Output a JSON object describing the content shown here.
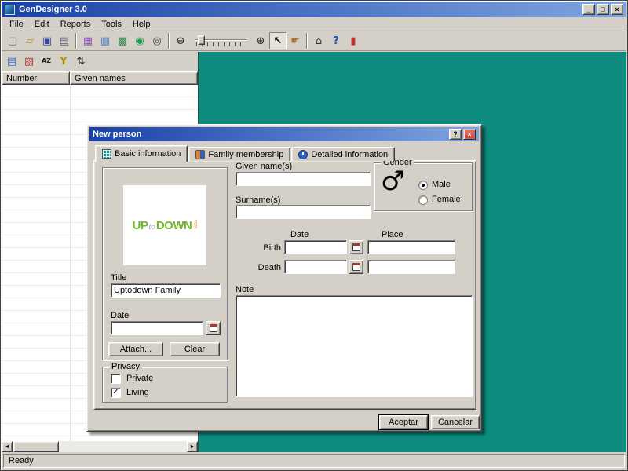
{
  "colors": {
    "workspace_teal": "#0e8c80",
    "titlebar_blue_dark": "#1941a5",
    "titlebar_blue_light": "#7fa5e0",
    "dialog_close_red": "#cf4032",
    "logo_green": "#76b82a",
    "logo_orange": "#f39200"
  },
  "window": {
    "title": "GenDesigner 3.0",
    "controls": {
      "minimize": "_",
      "maximize": "□",
      "close": "×"
    }
  },
  "menu": {
    "items": [
      "File",
      "Edit",
      "Reports",
      "Tools",
      "Help"
    ]
  },
  "toolbar_main": {
    "pointer_active": true,
    "items": [
      {
        "name": "new-document-icon",
        "glyph": "▢"
      },
      {
        "name": "open-folder-icon",
        "glyph": "▱"
      },
      {
        "name": "save-icon",
        "glyph": "▣"
      },
      {
        "name": "print-icon",
        "glyph": "▤"
      },
      {
        "name": "photo-album-icon",
        "glyph": "▦"
      },
      {
        "name": "chart-icon",
        "glyph": "▥"
      },
      {
        "name": "family-tree-icon",
        "glyph": "▩"
      },
      {
        "name": "world-icon",
        "glyph": "◉"
      },
      {
        "name": "find-icon",
        "glyph": "◎"
      },
      {
        "name": "zoom-out-icon",
        "glyph": "⊖"
      },
      {
        "name": "zoom-in-icon",
        "glyph": "⊕"
      },
      {
        "name": "pointer-tool-icon",
        "glyph": "↖"
      },
      {
        "name": "pan-tool-icon",
        "glyph": "☛"
      },
      {
        "name": "home-icon",
        "glyph": "⌂"
      },
      {
        "name": "help-icon",
        "glyph": "?"
      },
      {
        "name": "exit-icon",
        "glyph": "▮"
      }
    ]
  },
  "toolbar_panel": {
    "items": [
      {
        "name": "list-view-icon",
        "glyph": "▤"
      },
      {
        "name": "statistics-icon",
        "glyph": "▧"
      },
      {
        "name": "sort-alpha-icon",
        "glyph": "AZ"
      },
      {
        "name": "filter-icon",
        "glyph": "Y"
      },
      {
        "name": "sort-order-icon",
        "glyph": "⇅"
      }
    ]
  },
  "panel": {
    "columns": [
      "Number",
      "Given names"
    ],
    "scroll_left_glyph": "◄",
    "scroll_right_glyph": "►"
  },
  "statusbar": {
    "text": "Ready"
  },
  "dialog": {
    "title": "New person",
    "controls": {
      "help": "?",
      "close": "×"
    },
    "tabs": [
      {
        "label": "Basic information",
        "active": true
      },
      {
        "label": "Family membership",
        "active": false
      },
      {
        "label": "Detailed information",
        "active": false
      }
    ],
    "photo": {
      "logo_up": "UP",
      "logo_to": "to",
      "logo_down": "DOWN",
      "logo_com": "com"
    },
    "title_field": {
      "label": "Title",
      "value": "Uptodown Family"
    },
    "date_field": {
      "label": "Date",
      "value": ""
    },
    "attach_button": "Attach...",
    "clear_button": "Clear",
    "privacy": {
      "legend": "Privacy",
      "private_label": "Private",
      "living_label": "Living",
      "private_checked": false,
      "living_checked": true,
      "check_glyph": "✓"
    },
    "given": {
      "label": "Given name(s)",
      "value": ""
    },
    "surname": {
      "label": "Surname(s)",
      "value": ""
    },
    "gender": {
      "legend": "Gender",
      "symbol": "♂",
      "male_label": "Male",
      "female_label": "Female",
      "male_selected": true,
      "female_selected": false
    },
    "events": {
      "date_header": "Date",
      "place_header": "Place",
      "birth_label": "Birth",
      "death_label": "Death",
      "birth_date": "",
      "birth_place": "",
      "death_date": "",
      "death_place": ""
    },
    "note": {
      "label": "Note",
      "value": ""
    },
    "ok_button": "Aceptar",
    "cancel_button": "Cancelar"
  }
}
